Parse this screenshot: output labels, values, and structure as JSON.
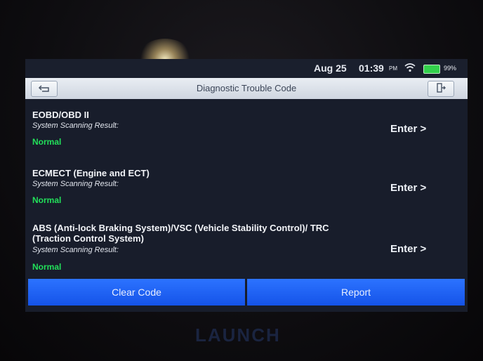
{
  "status_bar": {
    "date": "Aug 25",
    "time": "01:39",
    "ampm": "PM",
    "battery": "99%",
    "wifi_icon": "wifi-icon",
    "battery_icon": "battery-icon",
    "battery_color": "#33d14c"
  },
  "header": {
    "title": "Diagnostic Trouble Code",
    "back_icon": "back-icon",
    "exit_icon": "exit-icon"
  },
  "systems": [
    {
      "name": "EOBD/OBD II",
      "sub_label": "System Scanning Result:",
      "status": "Normal",
      "enter_label": "Enter"
    },
    {
      "name": "ECMECT (Engine and ECT)",
      "sub_label": "System Scanning Result:",
      "status": "Normal",
      "enter_label": "Enter"
    },
    {
      "name": "ABS (Anti-lock Braking System)/VSC (Vehicle Stability Control)/ TRC (Traction Control System)",
      "sub_label": "System Scanning Result:",
      "status": "Normal",
      "enter_label": "Enter"
    }
  ],
  "actions": {
    "clear_code": "Clear Code",
    "report": "Report"
  },
  "brand": "LAUNCH",
  "colors": {
    "accent_blue": "#1f63f5",
    "status_normal": "#22e05a"
  }
}
